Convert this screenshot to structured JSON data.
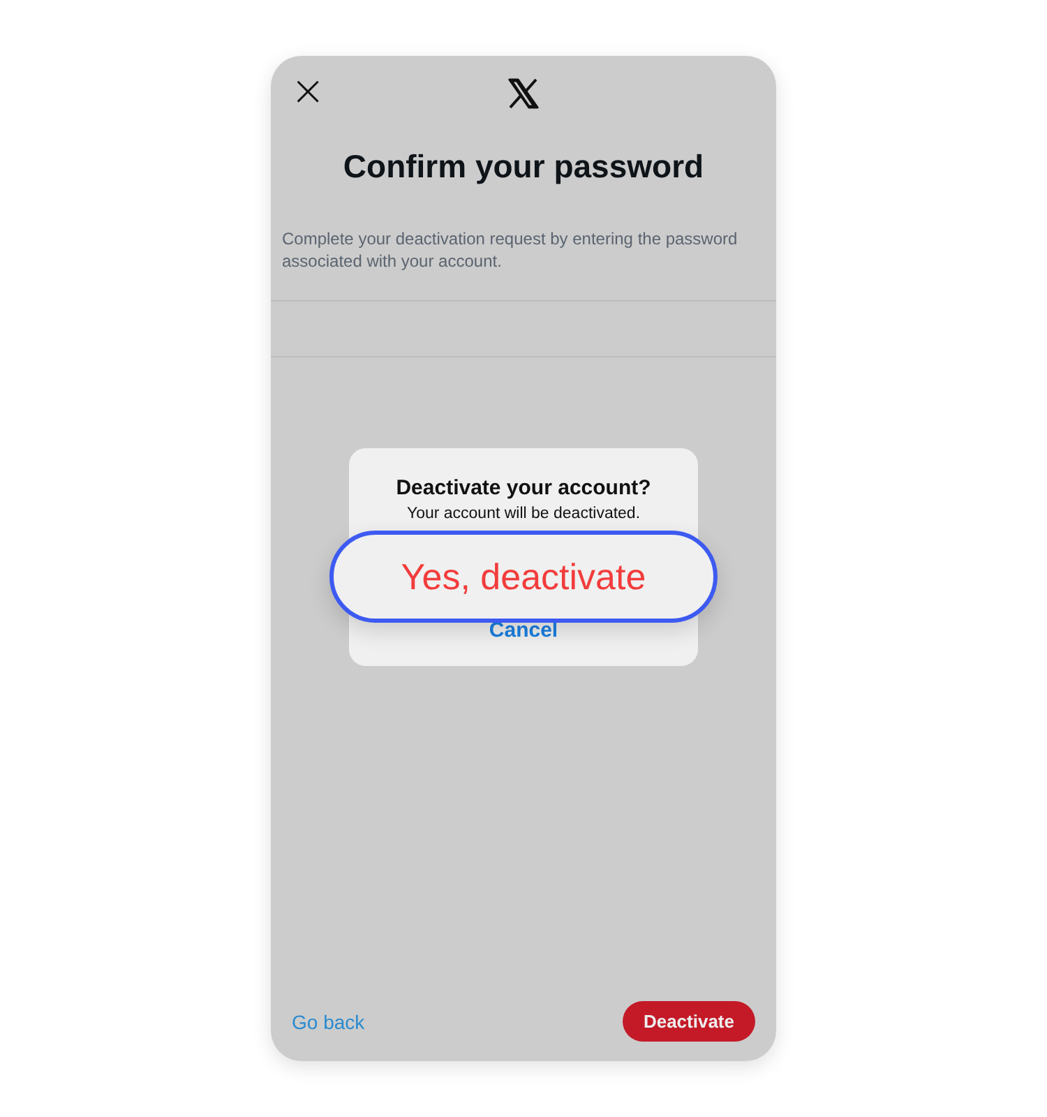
{
  "header": {
    "close_label": "×"
  },
  "title": "Confirm your password",
  "description": "Complete your deactivation request by entering the password associated with your account.",
  "alert": {
    "title": "Deactivate your account?",
    "message": "Your account will be deactivated.",
    "actions": [
      {
        "label": "Yes, deactivate",
        "kind": "destructive",
        "highlighted": true
      },
      {
        "label": "Cancel",
        "kind": "cancel",
        "highlighted": false
      }
    ]
  },
  "footer": {
    "back_link": "Go back",
    "primary_button": "Deactivate"
  }
}
